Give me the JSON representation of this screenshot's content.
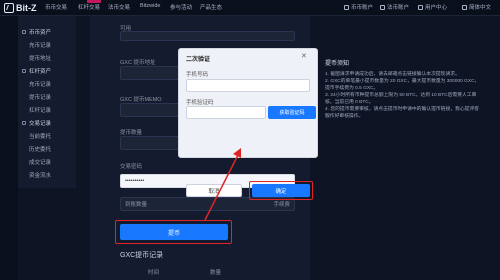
{
  "app": {
    "logo": "Bit-Z"
  },
  "nav": {
    "items": [
      "币币交易",
      "杠杆交易",
      "法币交易",
      "Bitzwide",
      "参与活动",
      "产品生态"
    ],
    "right": [
      "币币账户",
      "法币账户",
      "用户中心",
      "简体中文"
    ]
  },
  "sidebar": {
    "items": [
      {
        "label": "币币资产",
        "group": true
      },
      {
        "label": "充币记录",
        "group": false
      },
      {
        "label": "提币地址",
        "group": false
      },
      {
        "label": "杠杆资产",
        "group": true
      },
      {
        "label": "充币记录",
        "group": false
      },
      {
        "label": "提币记录",
        "group": false
      },
      {
        "label": "杠杆记录",
        "group": false
      },
      {
        "label": "交易记录",
        "group": true
      },
      {
        "label": "当前委托",
        "group": false
      },
      {
        "label": "历史委托",
        "group": false
      },
      {
        "label": "成交记录",
        "group": false
      },
      {
        "label": "资金流水",
        "group": false
      }
    ]
  },
  "form": {
    "currency_label": "可用",
    "address_label": "GXC 提币地址",
    "memo_label": "GXC 提币MEMO",
    "amount_label": "提币数量",
    "password_label": "交易密码",
    "password_value": "••••••••••",
    "arrival_label": "到账数量",
    "fee_label": "手续费",
    "submit": "提币",
    "records_title": "GXC提币记录",
    "records_col_time": "时间",
    "records_col_status": "数量"
  },
  "notice": {
    "title": "提币须知",
    "lines": [
      "1. 截图请求申请成功后，请去邮箱点击链接确认本次提现请求。",
      "2. GXC的单笔最小提币数量为 20 GXC，最大提币数量为 300000 GXC，提币手续费为 0.5 GXC。",
      "3. 24小时所有币种提币总额上限为 50 BTC，达到 10 BTC后需要人工审核，当前已用 0 BTC。",
      "4. 您的提币需要审核，请点击提币时申请中的确认提币链接，我心提评客服作好审核操作。"
    ]
  },
  "modal": {
    "title": "二次验证",
    "phone_label": "手机号码",
    "phone_placeholder": "",
    "code_label": "手机验证码",
    "code_placeholder": "",
    "get_code": "获取验证码",
    "cancel": "取消",
    "confirm": "确定"
  }
}
